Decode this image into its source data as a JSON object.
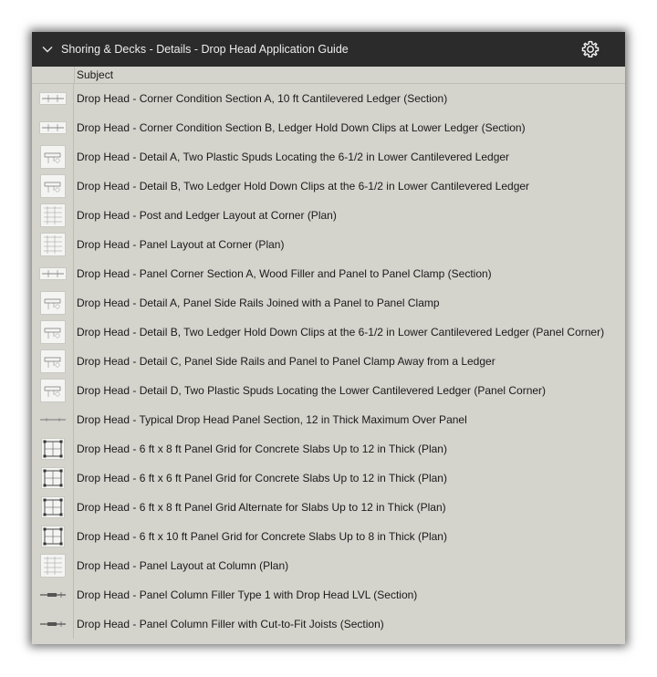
{
  "panel": {
    "title": "Shoring & Decks - Details - Drop Head Application Guide",
    "column_header": "Subject"
  },
  "rows": [
    {
      "label": "Drop Head - Corner Condition Section A, 10 ft Cantilevered Ledger (Section)",
      "thumb": "section"
    },
    {
      "label": "Drop Head - Corner Condition Section B, Ledger Hold Down Clips at Lower Ledger (Section)",
      "thumb": "section"
    },
    {
      "label": "Drop Head - Detail A, Two Plastic Spuds Locating the 6-1/2 in Lower Cantilevered Ledger",
      "thumb": "detail"
    },
    {
      "label": "Drop Head - Detail B, Two Ledger Hold Down Clips at the 6-1/2 in Lower Cantilevered Ledger",
      "thumb": "detail"
    },
    {
      "label": "Drop Head - Post and Ledger Layout at Corner (Plan)",
      "thumb": "plan"
    },
    {
      "label": "Drop Head - Panel Layout at Corner (Plan)",
      "thumb": "plan"
    },
    {
      "label": "Drop Head - Panel Corner Section A, Wood Filler and Panel to Panel Clamp (Section)",
      "thumb": "section"
    },
    {
      "label": "Drop Head - Detail A, Panel Side Rails Joined with a Panel to Panel Clamp",
      "thumb": "detail"
    },
    {
      "label": "Drop Head - Detail B, Two Ledger Hold Down Clips at the 6-1/2 in Lower Cantilevered Ledger (Panel Corner)",
      "thumb": "detail"
    },
    {
      "label": "Drop Head - Detail C, Panel Side Rails and Panel to Panel Clamp Away from a Ledger",
      "thumb": "detail"
    },
    {
      "label": "Drop Head - Detail D, Two Plastic Spuds Locating the Lower Cantilevered Ledger (Panel Corner)",
      "thumb": "detail"
    },
    {
      "label": "Drop Head - Typical Drop Head Panel Section, 12 in Thick Maximum Over Panel",
      "thumb": "line"
    },
    {
      "label": "Drop Head - 6 ft x 8 ft Panel Grid for Concrete Slabs Up to 12 in Thick (Plan)",
      "thumb": "grid"
    },
    {
      "label": "Drop Head - 6 ft x 6 ft Panel Grid for Concrete Slabs Up to 12 in Thick (Plan)",
      "thumb": "grid"
    },
    {
      "label": "Drop Head - 6 ft x 8 ft Panel Grid Alternate for Slabs Up to 12 in Thick (Plan)",
      "thumb": "grid"
    },
    {
      "label": "Drop Head - 6 ft x 10 ft Panel Grid for Concrete Slabs Up to 8 in Thick (Plan)",
      "thumb": "grid"
    },
    {
      "label": "Drop Head - Panel Layout at Column (Plan)",
      "thumb": "plan"
    },
    {
      "label": "Drop Head - Panel Column Filler Type 1 with Drop Head LVL (Section)",
      "thumb": "bar"
    },
    {
      "label": "Drop Head - Panel Column Filler with Cut-to-Fit Joists (Section)",
      "thumb": "bar"
    }
  ]
}
